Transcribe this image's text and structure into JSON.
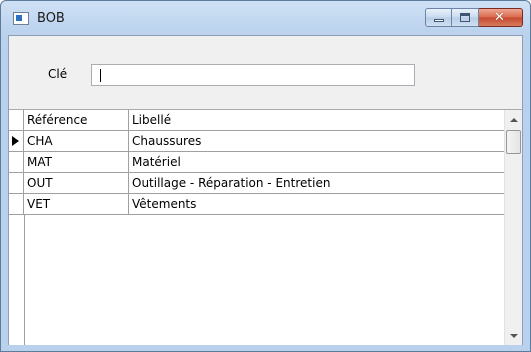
{
  "window": {
    "title": "BOB"
  },
  "search": {
    "label": "Clé",
    "value": ""
  },
  "grid": {
    "columns": [
      "Référence",
      "Libellé"
    ],
    "rows": [
      {
        "ref": "CHA",
        "libelle": "Chaussures",
        "selected": true
      },
      {
        "ref": "MAT",
        "libelle": "Matériel",
        "selected": false
      },
      {
        "ref": "OUT",
        "libelle": "Outillage - Réparation - Entretien",
        "selected": false
      },
      {
        "ref": "VET",
        "libelle": "Vêtements",
        "selected": false
      }
    ]
  }
}
